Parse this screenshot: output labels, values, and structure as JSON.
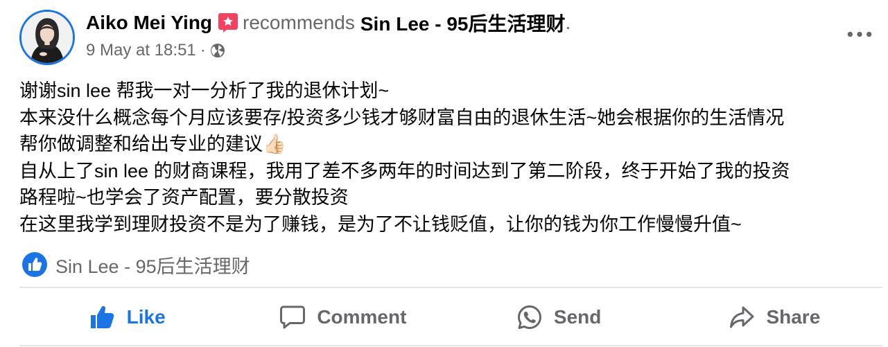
{
  "post": {
    "author": "Aiko Mei Ying",
    "recommends_text": "recommends",
    "page_name": "Sin Lee - 95后生活理财",
    "period": ".",
    "timestamp": "9 May at 18:51",
    "separator": "·",
    "privacy_icon": "globe-icon",
    "body_lines": [
      "谢谢sin lee 帮我一对一分析了我的退休计划~",
      "本来没什么概念每个月应该要存/投资多少钱才够财富自由的退休生活~她会根据你的生活情况",
      "帮你做调整和给出专业的建议👍🏻",
      "自从上了sin lee 的财商课程，我用了差不多两年的时间达到了第二阶段，终于开始了我的投资",
      "路程啦~也学会了资产配置，要分散投资",
      "在这里我学到理财投资不是为了赚钱，是为了不让钱贬值，让你的钱为你工作慢慢升值~"
    ],
    "tagged_page": "Sin Lee - 95后生活理财"
  },
  "actions": {
    "like_label": "Like",
    "comment_label": "Comment",
    "send_label": "Send",
    "share_label": "Share"
  },
  "colors": {
    "accent": "#1b74e4",
    "recommend_badge": "#f3425f",
    "secondary_text": "#65676b",
    "divider": "#e4e6eb"
  }
}
